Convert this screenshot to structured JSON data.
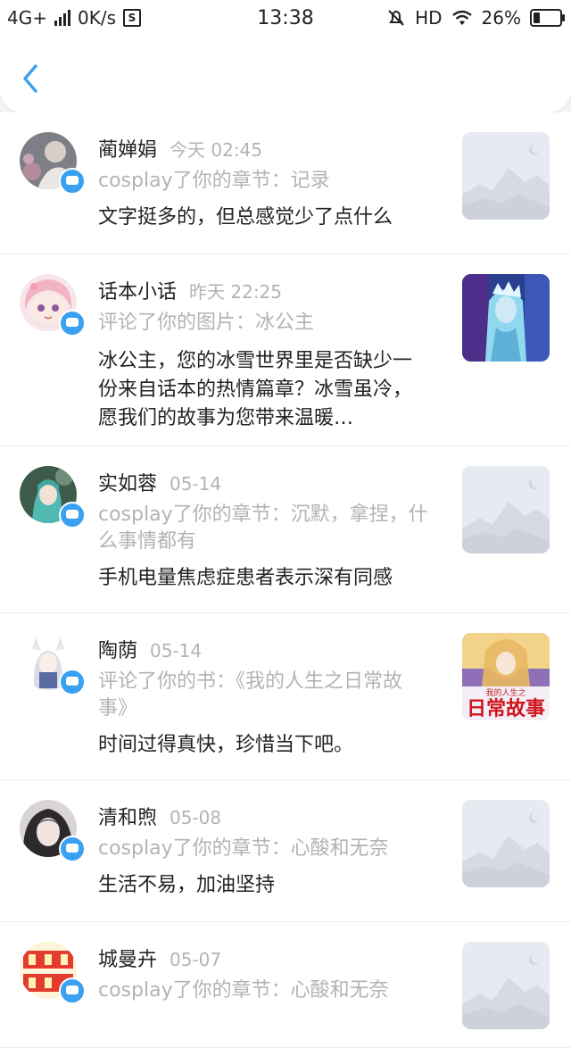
{
  "status_bar": {
    "network": "4G+",
    "speed": "0K/s",
    "s_icon": "S",
    "time": "13:38",
    "hd": "HD",
    "battery": "26%",
    "battery_level": 0.26
  },
  "header": {
    "back_icon": "chevron-left-icon"
  },
  "notifications": [
    {
      "name": "蔺婵娟",
      "time": "今天 02:45",
      "action": "cosplay了你的章节：记录",
      "comment": "文字挺多的，但总感觉少了点什么",
      "thumb": "placeholder"
    },
    {
      "name": "话本小话",
      "time": "昨天 22:25",
      "action": "评论了你的图片：冰公主",
      "comment": "冰公主，您的冰雪世界里是否缺少一份来自话本的热情篇章？冰雪虽冷，愿我们的故事为您带来温暖…",
      "thumb": "ice-princess"
    },
    {
      "name": "实如蓉",
      "time": "05-14",
      "action": "cosplay了你的章节：沉默，拿捏，什么事情都有",
      "comment": "手机电量焦虑症患者表示深有同感",
      "thumb": "placeholder"
    },
    {
      "name": "陶荫",
      "time": "05-14",
      "action": "评论了你的书：《我的人生之日常故事》",
      "comment": "时间过得真快，珍惜当下吧。",
      "thumb": "book-cover",
      "cover_title": "日常故事",
      "cover_subtitle": "我的人生之"
    },
    {
      "name": "清和煦",
      "time": "05-08",
      "action": "cosplay了你的章节：心酸和无奈",
      "comment": "生活不易，加油坚持",
      "thumb": "placeholder"
    },
    {
      "name": "城曼卉",
      "time": "05-07",
      "action": "cosplay了你的章节：心酸和无奈",
      "comment": "",
      "thumb": "placeholder"
    }
  ],
  "colors": {
    "accent": "#3aa0f0",
    "muted_text": "#b3b3b3",
    "text": "#222222"
  }
}
